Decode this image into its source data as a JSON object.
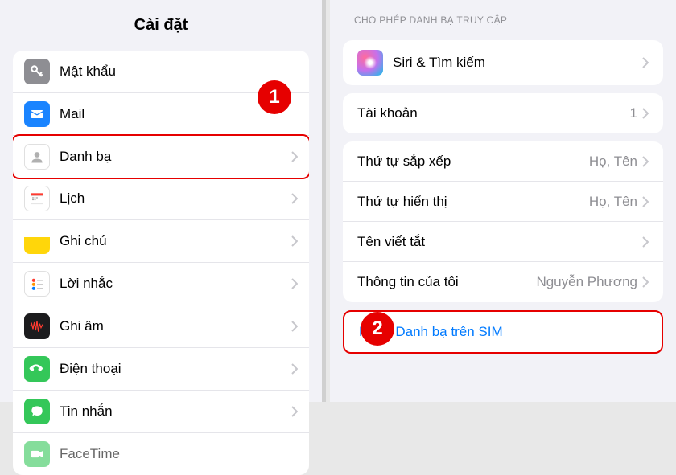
{
  "left": {
    "title": "Cài đặt",
    "items": [
      {
        "label": "Mật khẩu",
        "icon": "key"
      },
      {
        "label": "Mail",
        "icon": "mail"
      },
      {
        "label": "Danh bạ",
        "icon": "contacts",
        "highlight": true
      },
      {
        "label": "Lịch",
        "icon": "calendar"
      },
      {
        "label": "Ghi chú",
        "icon": "notes"
      },
      {
        "label": "Lời nhắc",
        "icon": "reminders"
      },
      {
        "label": "Ghi âm",
        "icon": "voice-memos"
      },
      {
        "label": "Điện thoại",
        "icon": "phone"
      },
      {
        "label": "Tin nhắn",
        "icon": "messages"
      },
      {
        "label": "FaceTime",
        "icon": "facetime"
      }
    ]
  },
  "right": {
    "section_header": "CHO PHÉP DANH BẠ TRUY CẬP",
    "siri_label": "Siri & Tìm kiếm",
    "accounts": {
      "label": "Tài khoản",
      "value": "1"
    },
    "options": [
      {
        "label": "Thứ tự sắp xếp",
        "value": "Họ, Tên"
      },
      {
        "label": "Thứ tự hiển thị",
        "value": "Họ, Tên"
      },
      {
        "label": "Tên viết tắt",
        "value": ""
      },
      {
        "label": "Thông tin của tôi",
        "value": "Nguyễn Phương"
      }
    ],
    "import_label": "Nhập Danh bạ trên SIM"
  },
  "badges": {
    "one": "1",
    "two": "2"
  }
}
